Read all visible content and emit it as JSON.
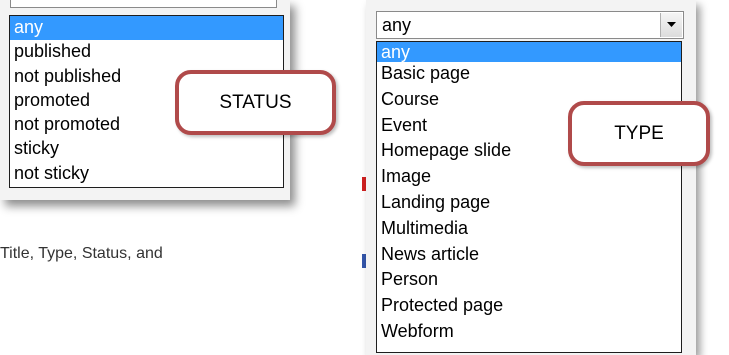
{
  "status_dropdown": {
    "options": [
      {
        "label": "any",
        "selected": true
      },
      {
        "label": "published",
        "selected": false
      },
      {
        "label": "not published",
        "selected": false
      },
      {
        "label": "promoted",
        "selected": false
      },
      {
        "label": "not promoted",
        "selected": false
      },
      {
        "label": "sticky",
        "selected": false
      },
      {
        "label": "not sticky",
        "selected": false
      }
    ]
  },
  "status_callout": {
    "label": "STATUS"
  },
  "type_dropdown": {
    "current_value": "any",
    "options": [
      {
        "label": "any",
        "selected": true
      },
      {
        "label": "Basic page",
        "selected": false
      },
      {
        "label": "Course",
        "selected": false
      },
      {
        "label": "Event",
        "selected": false
      },
      {
        "label": "Homepage slide",
        "selected": false
      },
      {
        "label": "Image",
        "selected": false
      },
      {
        "label": "Landing page",
        "selected": false
      },
      {
        "label": "Multimedia",
        "selected": false
      },
      {
        "label": "News article",
        "selected": false
      },
      {
        "label": "Person",
        "selected": false
      },
      {
        "label": "Protected page",
        "selected": false
      },
      {
        "label": "Webform",
        "selected": false
      }
    ]
  },
  "type_callout": {
    "label": "TYPE"
  },
  "caption": {
    "text": "Title, Type, Status, and"
  },
  "colors": {
    "selection": "#3399ff",
    "callout_border": "#b04a4a"
  },
  "icons": {
    "dropdown_arrow": "chevron-down-icon"
  }
}
